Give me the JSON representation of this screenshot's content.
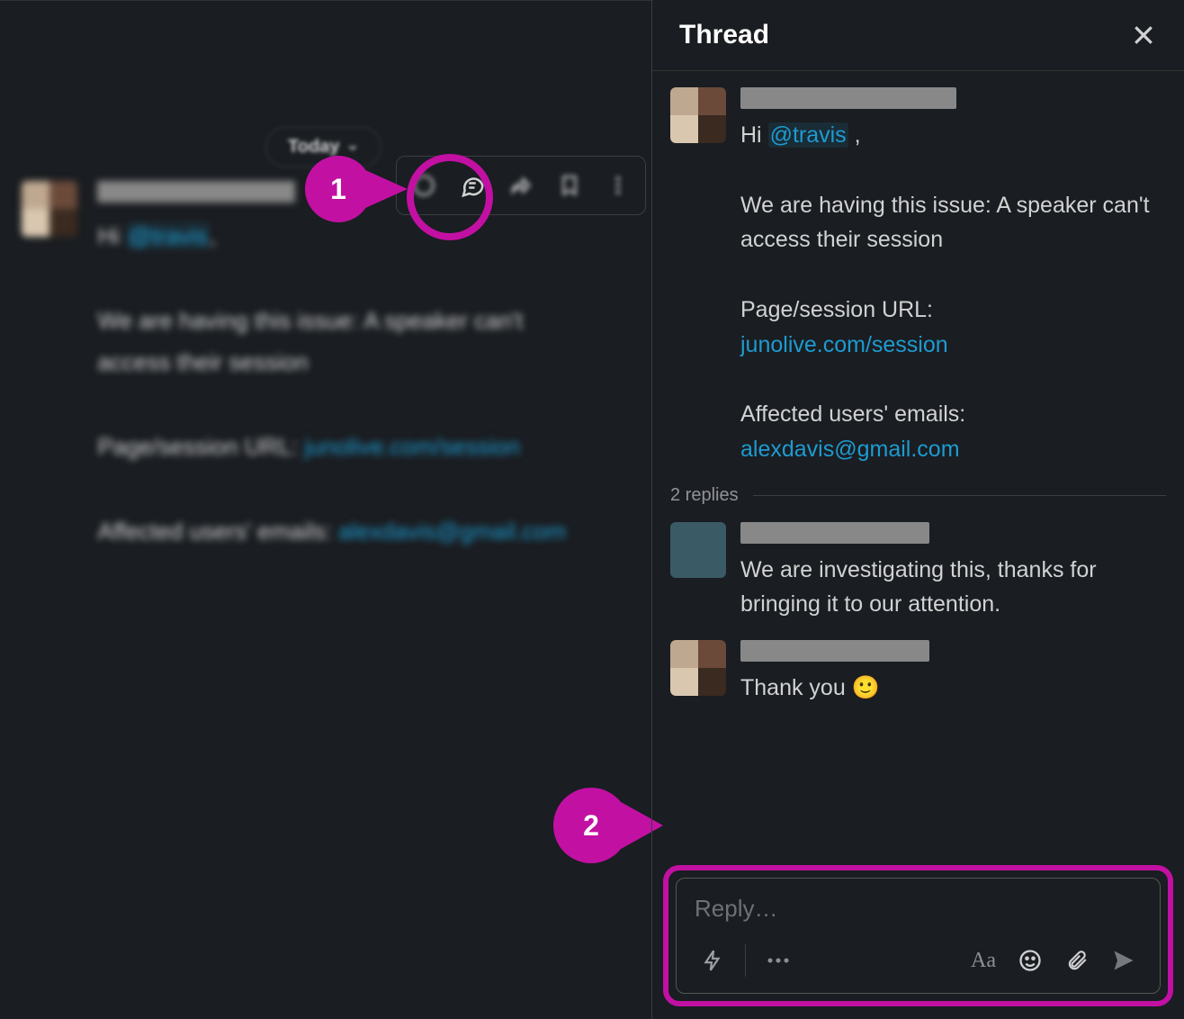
{
  "main": {
    "date_label": "Today",
    "message": {
      "greeting": "Hi ",
      "mention": "@travis",
      "greeting_punct": ",",
      "issue_line": "We are having this issue: A speaker can't access their session",
      "url_label": "Page/session URL: ",
      "url": "junolive.com/session",
      "emails_label": "Affected users' emails: ",
      "email": "alexdavis@gmail.com"
    }
  },
  "thread": {
    "title": "Thread",
    "original": {
      "greeting": "Hi ",
      "mention": "@travis",
      "greeting_punct": " ,",
      "issue_line": "We are having this issue: A speaker can't access their session",
      "url_label": "Page/session URL:",
      "url": "junolive.com/session",
      "emails_label": "Affected users' emails:",
      "email": "alexdavis@gmail.com"
    },
    "replies_label": "2 replies",
    "reply1": "We are investigating this, thanks for bringing it to our attention.",
    "reply2_text": "Thank you ",
    "reply2_emoji": "🙂",
    "reply_placeholder": "Reply…"
  },
  "callouts": {
    "one": "1",
    "two": "2"
  }
}
